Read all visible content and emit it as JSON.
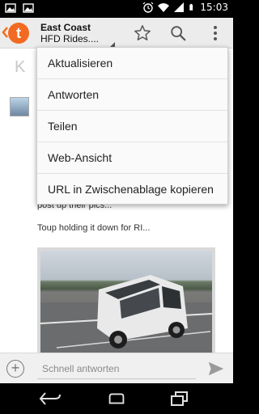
{
  "status_bar": {
    "time": "15:03",
    "left_icons": [
      "image-icon",
      "image-icon"
    ],
    "right_icons": [
      "alarm-icon",
      "wifi-icon",
      "signal-icon",
      "battery-icon"
    ]
  },
  "action_bar": {
    "app_icon": "tapatalk-logo",
    "app_logo_letter": "t",
    "title_line1": "East Coast",
    "title_line2": "HFD Rides....",
    "icons": [
      "star-icon",
      "search-icon",
      "overflow-menu-icon"
    ]
  },
  "content": {
    "header_initial": "K",
    "post_text_1": "post up their pics...",
    "post_text_2": "Toup holding it down for RI..."
  },
  "overflow_menu": {
    "items": [
      "Aktualisieren",
      "Antworten",
      "Teilen",
      "Web-Ansicht",
      "URL in Zwischenablage kopieren"
    ]
  },
  "quick_reply": {
    "placeholder": "Schnell antworten",
    "plus_icon": "plus-icon",
    "send_icon": "send-icon"
  },
  "nav_bar": {
    "icons": [
      "back-icon",
      "home-icon",
      "recents-icon"
    ]
  },
  "colors": {
    "accent": "#f26a21",
    "action_bar_bg": "#ececec",
    "menu_bg": "#fafafa"
  }
}
